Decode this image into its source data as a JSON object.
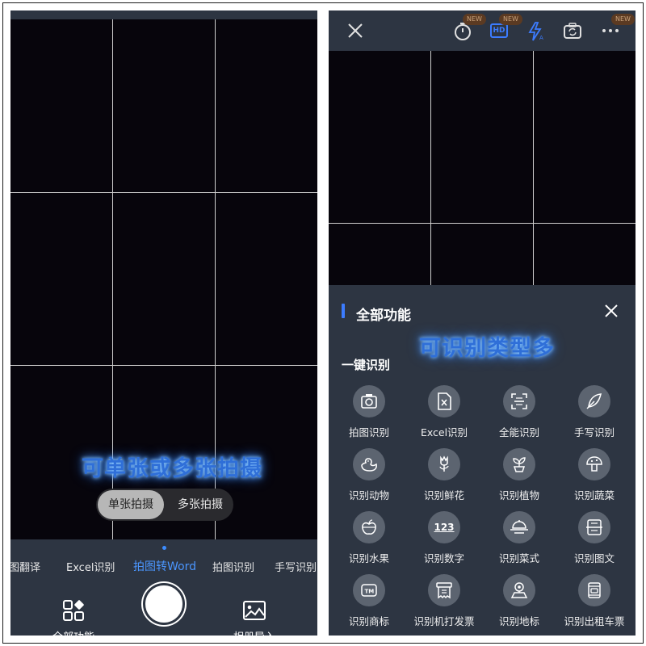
{
  "left": {
    "caption": "可单张或多张拍摄",
    "capture_modes": [
      "单张拍摄",
      "多张拍摄"
    ],
    "mode_tabs": [
      "图翻译",
      "Excel识别",
      "拍图转Word",
      "拍图识别",
      "手写识别"
    ],
    "current_tab": "拍图转Word",
    "all_functions_label": "全部功能",
    "album_import_label": "相册导入"
  },
  "right": {
    "toolbar": {
      "icons": [
        "close-icon",
        "timer-icon",
        "hd-icon",
        "flash-auto-icon",
        "switch-camera-icon",
        "more-icon"
      ],
      "badge": "NEW",
      "hd_text": "HD"
    },
    "caption": "可识别类型多",
    "sheet_title": "全部功能",
    "section_title": "一键识别",
    "features": [
      {
        "label": "拍图识别",
        "icon": "camera-scan-icon"
      },
      {
        "label": "Excel识别",
        "icon": "excel-file-icon"
      },
      {
        "label": "全能识别",
        "icon": "all-scan-icon"
      },
      {
        "label": "手写识别",
        "icon": "feather-pen-icon"
      },
      {
        "label": "识别动物",
        "icon": "duck-icon"
      },
      {
        "label": "识别鲜花",
        "icon": "flower-icon"
      },
      {
        "label": "识别植物",
        "icon": "plant-pot-icon"
      },
      {
        "label": "识别蔬菜",
        "icon": "mushroom-icon"
      },
      {
        "label": "识别水果",
        "icon": "apple-icon"
      },
      {
        "label": "识别数字",
        "icon": "numbers-icon"
      },
      {
        "label": "识别菜式",
        "icon": "dish-icon"
      },
      {
        "label": "识别图文",
        "icon": "document-scan-icon"
      },
      {
        "label": "识别商标",
        "icon": "trademark-icon"
      },
      {
        "label": "识别机打发票",
        "icon": "invoice-icon"
      },
      {
        "label": "识别地标",
        "icon": "landmark-icon"
      },
      {
        "label": "识别出租车票",
        "icon": "taxi-receipt-icon"
      }
    ],
    "numbers_glyph": "123"
  }
}
